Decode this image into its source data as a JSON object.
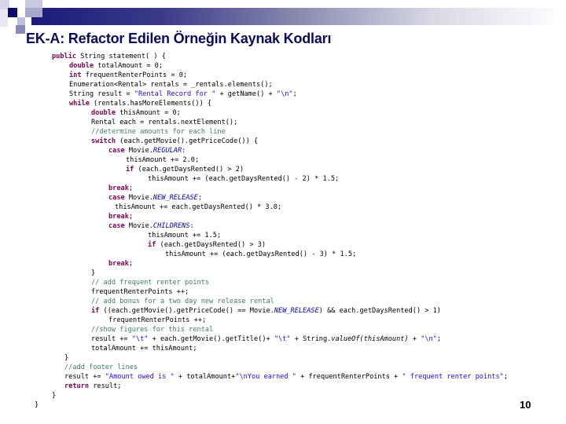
{
  "slide": {
    "title": "EK-A: Refactor Edilen Örneğin Kaynak Kodları",
    "page_number": "10",
    "colors": {
      "title": "#0a0a5a",
      "banner_start": "#1a1a7a",
      "keyword": "#7f0055",
      "string": "#2a00ff",
      "comment": "#3f7f5f",
      "static_field": "#0000c0"
    }
  },
  "code_lines": [
    {
      "indent": 66,
      "segments": [
        {
          "t": "public",
          "c": "kw"
        },
        {
          "t": " String statement( ) {"
        }
      ]
    },
    {
      "indent": 88,
      "segments": [
        {
          "t": "double",
          "c": "kw"
        },
        {
          "t": " totalAmount = 0;"
        }
      ]
    },
    {
      "indent": 88,
      "segments": [
        {
          "t": "int",
          "c": "kw"
        },
        {
          "t": " frequentRenterPoints = 0;"
        }
      ]
    },
    {
      "indent": 88,
      "segments": [
        {
          "t": "Enumeration<Rental> rentals = _rentals.elements();"
        }
      ]
    },
    {
      "indent": 88,
      "segments": [
        {
          "t": "String result = "
        },
        {
          "t": "\"Rental Record for \"",
          "c": "str"
        },
        {
          "t": " + getName() + "
        },
        {
          "t": "\"\\n\"",
          "c": "str"
        },
        {
          "t": ";"
        }
      ]
    },
    {
      "indent": 88,
      "segments": [
        {
          "t": "while",
          "c": "kw"
        },
        {
          "t": " (rentals.hasMoreElements()) {"
        }
      ]
    },
    {
      "indent": 116,
      "segments": [
        {
          "t": "double",
          "c": "kw"
        },
        {
          "t": " thisAmount = 0;"
        }
      ]
    },
    {
      "indent": 116,
      "segments": [
        {
          "t": "Rental each = rentals.nextElement();"
        }
      ]
    },
    {
      "indent": 116,
      "segments": [
        {
          "t": "//determine amounts for each line",
          "c": "cm"
        }
      ]
    },
    {
      "indent": 116,
      "segments": [
        {
          "t": "switch",
          "c": "kw"
        },
        {
          "t": " (each.getMovie().getPriceCode()) {"
        }
      ]
    },
    {
      "indent": 138,
      "segments": [
        {
          "t": "case",
          "c": "kw"
        },
        {
          "t": " Movie."
        },
        {
          "t": "REGULAR",
          "c": "fld"
        },
        {
          "t": ":"
        }
      ]
    },
    {
      "indent": 160,
      "segments": [
        {
          "t": "thisAmount += 2.0;"
        }
      ]
    },
    {
      "indent": 160,
      "segments": [
        {
          "t": "if",
          "c": "kw"
        },
        {
          "t": " (each.getDaysRented() > 2)"
        }
      ]
    },
    {
      "indent": 188,
      "segments": [
        {
          "t": "thisAmount += (each.getDaysRented() - 2) * 1.5;"
        }
      ]
    },
    {
      "indent": 138,
      "segments": [
        {
          "t": "break",
          "c": "kw"
        },
        {
          "t": ";"
        }
      ]
    },
    {
      "indent": 138,
      "segments": [
        {
          "t": "case",
          "c": "kw"
        },
        {
          "t": " Movie."
        },
        {
          "t": "NEW_RELEASE",
          "c": "fld"
        },
        {
          "t": ":"
        }
      ]
    },
    {
      "indent": 146,
      "segments": [
        {
          "t": "thisAmount += each.getDaysRented() * 3.0;"
        }
      ]
    },
    {
      "indent": 138,
      "segments": [
        {
          "t": "break",
          "c": "kw"
        },
        {
          "t": ";"
        }
      ]
    },
    {
      "indent": 138,
      "segments": [
        {
          "t": "case",
          "c": "kw"
        },
        {
          "t": " Movie."
        },
        {
          "t": "CHILDRENS",
          "c": "fld"
        },
        {
          "t": ":"
        }
      ]
    },
    {
      "indent": 188,
      "segments": [
        {
          "t": "thisAmount += 1.5;"
        }
      ]
    },
    {
      "indent": 188,
      "segments": [
        {
          "t": "if",
          "c": "kw"
        },
        {
          "t": " (each.getDaysRented() > 3)"
        }
      ]
    },
    {
      "indent": 210,
      "segments": [
        {
          "t": "thisAmount += (each.getDaysRented() - 3) * 1.5;"
        }
      ]
    },
    {
      "indent": 138,
      "segments": [
        {
          "t": "break",
          "c": "kw"
        },
        {
          "t": ";"
        }
      ]
    },
    {
      "indent": 116,
      "segments": [
        {
          "t": "}"
        }
      ]
    },
    {
      "indent": 116,
      "segments": [
        {
          "t": "// add frequent renter points",
          "c": "cm"
        }
      ]
    },
    {
      "indent": 116,
      "segments": [
        {
          "t": "frequentRenterPoints ++;"
        }
      ]
    },
    {
      "indent": 116,
      "segments": [
        {
          "t": "// add bonus for a two day new release rental",
          "c": "cm"
        }
      ]
    },
    {
      "indent": 116,
      "segments": [
        {
          "t": "if",
          "c": "kw"
        },
        {
          "t": " ((each.getMovie().getPriceCode() == Movie."
        },
        {
          "t": "NEW_RELEASE",
          "c": "fld"
        },
        {
          "t": ") && each.getDaysRented() > 1)"
        }
      ]
    },
    {
      "indent": 138,
      "segments": [
        {
          "t": "frequentRenterPoints ++;"
        }
      ]
    },
    {
      "indent": 116,
      "segments": [
        {
          "t": "//show figures for this rental",
          "c": "cm"
        }
      ]
    },
    {
      "indent": 116,
      "segments": [
        {
          "t": "result += "
        },
        {
          "t": "\"\\t\"",
          "c": "str"
        },
        {
          "t": " + each.getMovie().getTitle()+ "
        },
        {
          "t": "\"\\t\"",
          "c": "str"
        },
        {
          "t": " + String."
        },
        {
          "t": "valueOf(thisAmount)",
          "c": "ital"
        },
        {
          "t": " + "
        },
        {
          "t": "\"\\n\"",
          "c": "str"
        },
        {
          "t": ";"
        }
      ]
    },
    {
      "indent": 116,
      "segments": [
        {
          "t": "totalAmount += thisAmount;"
        }
      ]
    },
    {
      "indent": 82,
      "segments": [
        {
          "t": "}"
        }
      ]
    },
    {
      "indent": 82,
      "segments": [
        {
          "t": "//add footer lines",
          "c": "cm"
        }
      ]
    },
    {
      "indent": 82,
      "segments": [
        {
          "t": "result += "
        },
        {
          "t": "\"Amount owed is \"",
          "c": "str"
        },
        {
          "t": " + totalAmount+"
        },
        {
          "t": "\"\\nYou earned \"",
          "c": "str"
        },
        {
          "t": " + frequentRenterPoints + "
        },
        {
          "t": "\" frequent renter points\"",
          "c": "str"
        },
        {
          "t": ";"
        }
      ]
    },
    {
      "indent": 82,
      "segments": [
        {
          "t": "return",
          "c": "kw"
        },
        {
          "t": " result;"
        }
      ]
    },
    {
      "indent": 66,
      "segments": [
        {
          "t": "}"
        }
      ]
    },
    {
      "indent": 44,
      "segments": [
        {
          "t": "}"
        }
      ]
    }
  ]
}
